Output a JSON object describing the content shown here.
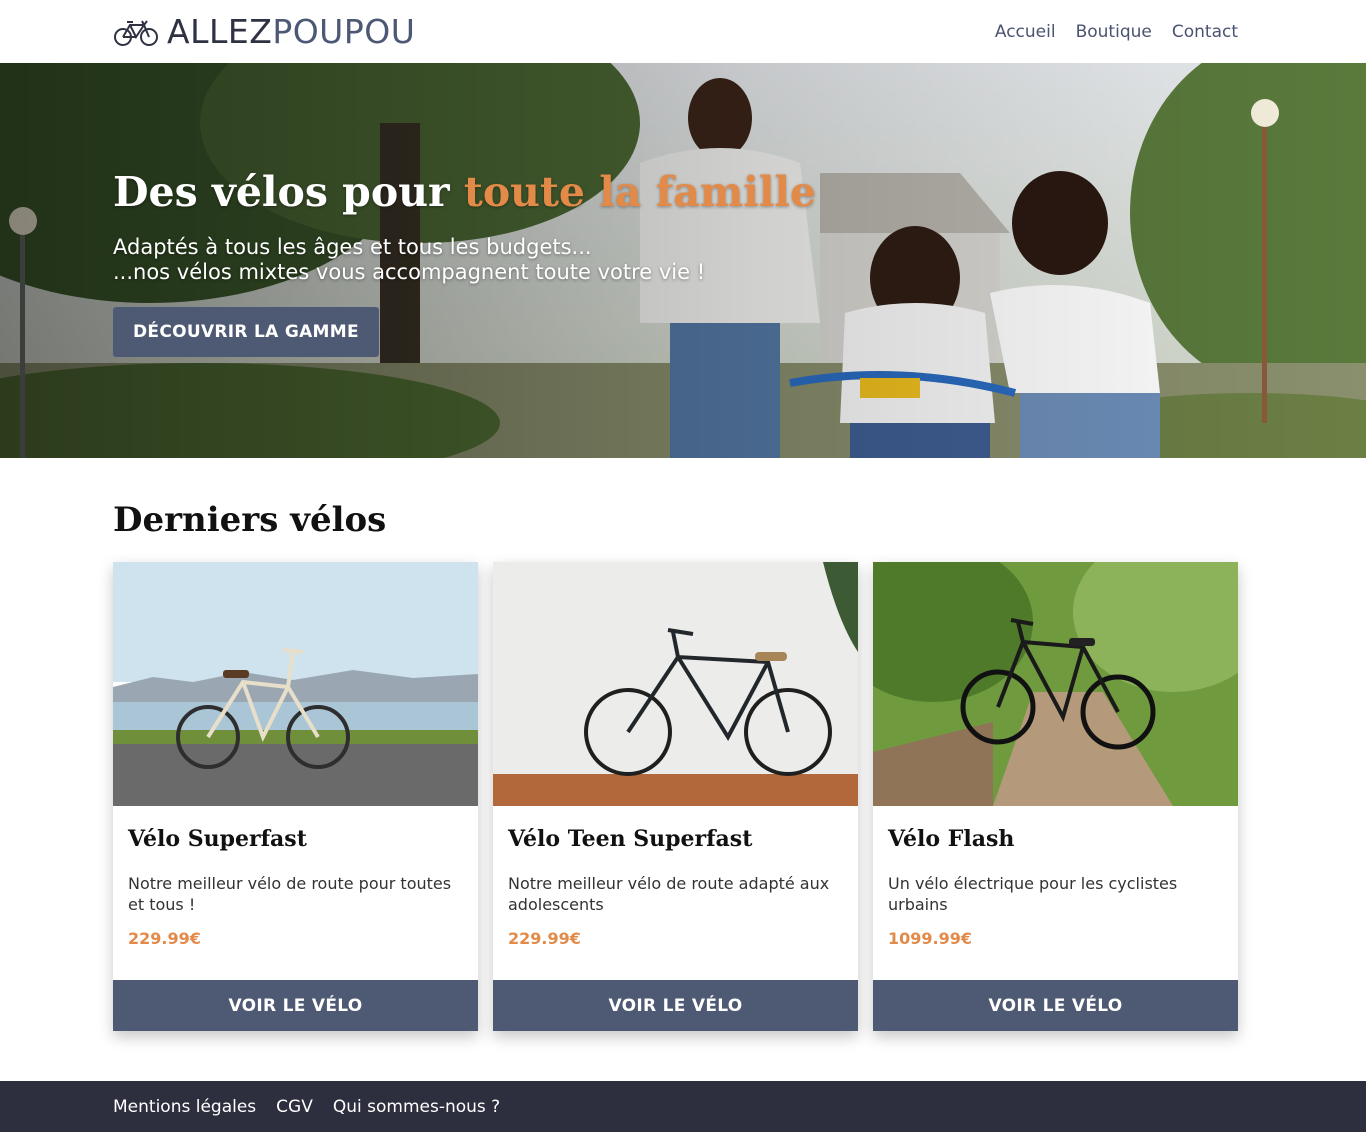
{
  "brand": {
    "part1": "ALLEZ",
    "part2": "POUPOU"
  },
  "nav": {
    "items": [
      {
        "label": "Accueil"
      },
      {
        "label": "Boutique"
      },
      {
        "label": "Contact"
      }
    ]
  },
  "hero": {
    "title_part1": "Des vélos pour ",
    "title_accent": "toute la famille",
    "subtitle_line1": "Adaptés à tous les âges et tous les budgets...",
    "subtitle_line2": "...nos vélos mixtes vous accompagnent toute votre vie !",
    "cta_label": "DÉCOUVRIR LA GAMME"
  },
  "products": {
    "section_title": "Derniers vélos",
    "items": [
      {
        "name": "Vélo Superfast",
        "description": "Notre meilleur vélo de route pour toutes et tous !",
        "price": "229.99€",
        "button": "VOIR LE VÉLO"
      },
      {
        "name": "Vélo Teen Superfast",
        "description": "Notre meilleur vélo de route adapté aux adolescents",
        "price": "229.99€",
        "button": "VOIR LE VÉLO"
      },
      {
        "name": "Vélo Flash",
        "description": "Un vélo électrique pour les cyclistes urbains",
        "price": "1099.99€",
        "button": "VOIR LE VÉLO"
      }
    ]
  },
  "footer": {
    "links": [
      {
        "label": "Mentions légales"
      },
      {
        "label": "CGV"
      },
      {
        "label": "Qui sommes-nous ?"
      }
    ]
  },
  "colors": {
    "accent": "#e38a48",
    "primary": "#4e5a73",
    "footer_bg": "#2d2f3e"
  }
}
